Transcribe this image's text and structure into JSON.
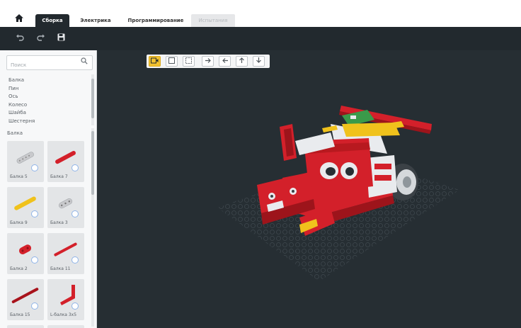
{
  "tabs": {
    "home_icon": "home-icon",
    "items": [
      {
        "label": "Сборка",
        "state": "active"
      },
      {
        "label": "Электрика",
        "state": "normal"
      },
      {
        "label": "Программирование",
        "state": "normal"
      },
      {
        "label": "Испытания",
        "state": "disabled"
      }
    ]
  },
  "toolbar": {
    "undo_icon": "undo-icon",
    "redo_icon": "redo-icon",
    "save_icon": "save-icon"
  },
  "sidebar": {
    "search": {
      "placeholder": "Поиск",
      "value": ""
    },
    "categories": [
      "Балка",
      "Пин",
      "Ось",
      "Колесо",
      "Шайба",
      "Шестерня"
    ],
    "grid_title": "Балка",
    "parts": [
      {
        "label": "Балка 5",
        "color": "#c8c9cc"
      },
      {
        "label": "Балка 7",
        "color": "#d3202a"
      },
      {
        "label": "Балка 9",
        "color": "#f0c21c"
      },
      {
        "label": "Балка 3",
        "color": "#c8c9cc"
      },
      {
        "label": "Балка 2",
        "color": "#d3202a"
      },
      {
        "label": "Балка 11",
        "color": "#d3202a"
      },
      {
        "label": "Балка 15",
        "color": "#d3202a"
      },
      {
        "label": "L-балка 3x5",
        "color": "#d3202a"
      }
    ]
  },
  "viewport": {
    "tools": [
      "camera-icon",
      "square-select-icon",
      "dashed-select-icon",
      "arrow-right-icon",
      "arrow-left-icon",
      "arrow-up-icon",
      "arrow-down-icon"
    ],
    "active_tool": "camera-icon",
    "background": "#262e33",
    "model_colors": {
      "red": "#d3202a",
      "white": "#e9ebee",
      "yellow": "#f0c21c",
      "dark_gray": "#3b4146",
      "green": "#3a9a4a"
    }
  }
}
